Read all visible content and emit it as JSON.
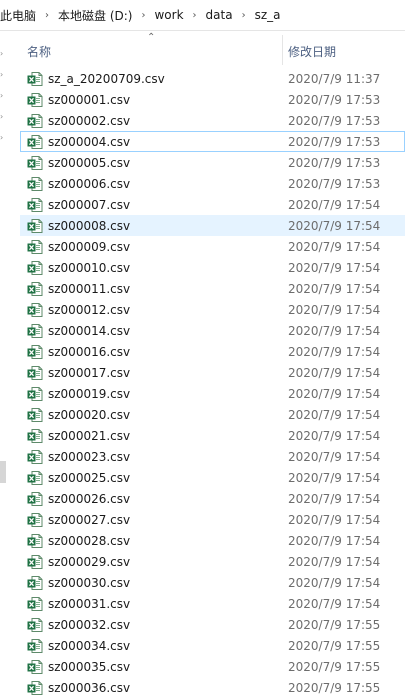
{
  "breadcrumb": [
    "此电脑",
    "本地磁盘 (D:)",
    "work",
    "data",
    "sz_a"
  ],
  "columns": {
    "name": "名称",
    "date": "修改日期"
  },
  "focused_index": 3,
  "hover_index": 7,
  "files": [
    {
      "name": "sz_a_20200709.csv",
      "date": "2020/7/9 11:37"
    },
    {
      "name": "sz000001.csv",
      "date": "2020/7/9 17:53"
    },
    {
      "name": "sz000002.csv",
      "date": "2020/7/9 17:53"
    },
    {
      "name": "sz000004.csv",
      "date": "2020/7/9 17:53"
    },
    {
      "name": "sz000005.csv",
      "date": "2020/7/9 17:53"
    },
    {
      "name": "sz000006.csv",
      "date": "2020/7/9 17:53"
    },
    {
      "name": "sz000007.csv",
      "date": "2020/7/9 17:54"
    },
    {
      "name": "sz000008.csv",
      "date": "2020/7/9 17:54"
    },
    {
      "name": "sz000009.csv",
      "date": "2020/7/9 17:54"
    },
    {
      "name": "sz000010.csv",
      "date": "2020/7/9 17:54"
    },
    {
      "name": "sz000011.csv",
      "date": "2020/7/9 17:54"
    },
    {
      "name": "sz000012.csv",
      "date": "2020/7/9 17:54"
    },
    {
      "name": "sz000014.csv",
      "date": "2020/7/9 17:54"
    },
    {
      "name": "sz000016.csv",
      "date": "2020/7/9 17:54"
    },
    {
      "name": "sz000017.csv",
      "date": "2020/7/9 17:54"
    },
    {
      "name": "sz000019.csv",
      "date": "2020/7/9 17:54"
    },
    {
      "name": "sz000020.csv",
      "date": "2020/7/9 17:54"
    },
    {
      "name": "sz000021.csv",
      "date": "2020/7/9 17:54"
    },
    {
      "name": "sz000023.csv",
      "date": "2020/7/9 17:54"
    },
    {
      "name": "sz000025.csv",
      "date": "2020/7/9 17:54"
    },
    {
      "name": "sz000026.csv",
      "date": "2020/7/9 17:54"
    },
    {
      "name": "sz000027.csv",
      "date": "2020/7/9 17:54"
    },
    {
      "name": "sz000028.csv",
      "date": "2020/7/9 17:54"
    },
    {
      "name": "sz000029.csv",
      "date": "2020/7/9 17:54"
    },
    {
      "name": "sz000030.csv",
      "date": "2020/7/9 17:54"
    },
    {
      "name": "sz000031.csv",
      "date": "2020/7/9 17:54"
    },
    {
      "name": "sz000032.csv",
      "date": "2020/7/9 17:55"
    },
    {
      "name": "sz000034.csv",
      "date": "2020/7/9 17:55"
    },
    {
      "name": "sz000035.csv",
      "date": "2020/7/9 17:55"
    },
    {
      "name": "sz000036.csv",
      "date": "2020/7/9 17:55"
    }
  ],
  "icons": {
    "file": "excel-csv-icon",
    "nav_expand": "chevron-right-icon",
    "sort": "sort-ascending-icon"
  },
  "colors": {
    "excel_green": "#1f7244",
    "hover_bg": "#e5f3ff",
    "focus_border": "#99d1ff",
    "header_text": "#4d6082"
  }
}
